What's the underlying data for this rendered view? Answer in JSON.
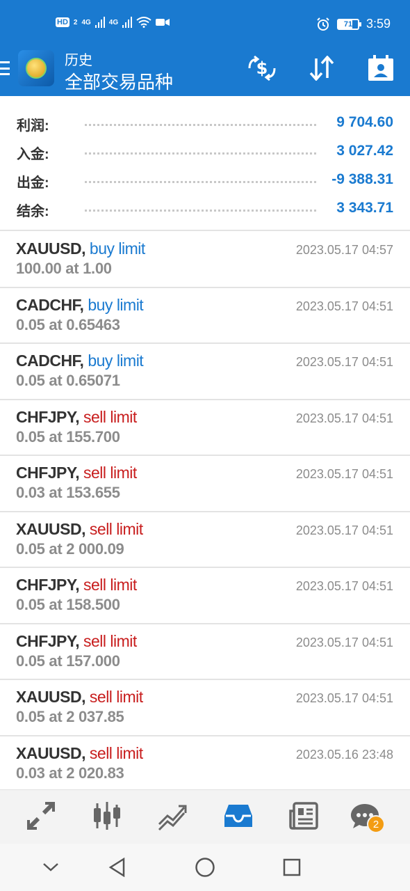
{
  "status_bar": {
    "hd_label": "HD",
    "hd_sub": "2",
    "net1": "4G",
    "net2": "4G",
    "battery": "71",
    "time": "3:59"
  },
  "app_bar": {
    "title_small": "历史",
    "title_large": "全部交易品种"
  },
  "summary": [
    {
      "label": "利润:",
      "value": "9 704.60"
    },
    {
      "label": "入金:",
      "value": "3 027.42"
    },
    {
      "label": "出金:",
      "value": "-9 388.31"
    },
    {
      "label": "结余:",
      "value": "3 343.71"
    }
  ],
  "orders": [
    {
      "symbol": "XAUUSD,",
      "type": "buy limit",
      "side": "buy",
      "detail": "100.00 at 1.00",
      "time": "2023.05.17 04:57"
    },
    {
      "symbol": "CADCHF,",
      "type": "buy limit",
      "side": "buy",
      "detail": "0.05 at 0.65463",
      "time": "2023.05.17 04:51"
    },
    {
      "symbol": "CADCHF,",
      "type": "buy limit",
      "side": "buy",
      "detail": "0.05 at 0.65071",
      "time": "2023.05.17 04:51"
    },
    {
      "symbol": "CHFJPY,",
      "type": "sell limit",
      "side": "sell",
      "detail": "0.05 at 155.700",
      "time": "2023.05.17 04:51"
    },
    {
      "symbol": "CHFJPY,",
      "type": "sell limit",
      "side": "sell",
      "detail": "0.03 at 153.655",
      "time": "2023.05.17 04:51"
    },
    {
      "symbol": "XAUUSD,",
      "type": "sell limit",
      "side": "sell",
      "detail": "0.05 at 2 000.09",
      "time": "2023.05.17 04:51"
    },
    {
      "symbol": "CHFJPY,",
      "type": "sell limit",
      "side": "sell",
      "detail": "0.05 at 158.500",
      "time": "2023.05.17 04:51"
    },
    {
      "symbol": "CHFJPY,",
      "type": "sell limit",
      "side": "sell",
      "detail": "0.05 at 157.000",
      "time": "2023.05.17 04:51"
    },
    {
      "symbol": "XAUUSD,",
      "type": "sell limit",
      "side": "sell",
      "detail": "0.05 at 2 037.85",
      "time": "2023.05.17 04:51"
    },
    {
      "symbol": "XAUUSD,",
      "type": "sell limit",
      "side": "sell",
      "detail": "0.03 at 2 020.83",
      "time": "2023.05.16 23:48"
    }
  ],
  "bottom_nav": {
    "items": [
      "quotes-icon",
      "chart-icon",
      "trade-icon",
      "history-icon",
      "news-icon",
      "chat-icon"
    ],
    "active": "history-icon",
    "chat_badge": "2"
  },
  "colors": {
    "primary": "#1a7ad0",
    "buy": "#1a7ad0",
    "sell": "#c81e1e",
    "muted": "#8c8c8c"
  }
}
